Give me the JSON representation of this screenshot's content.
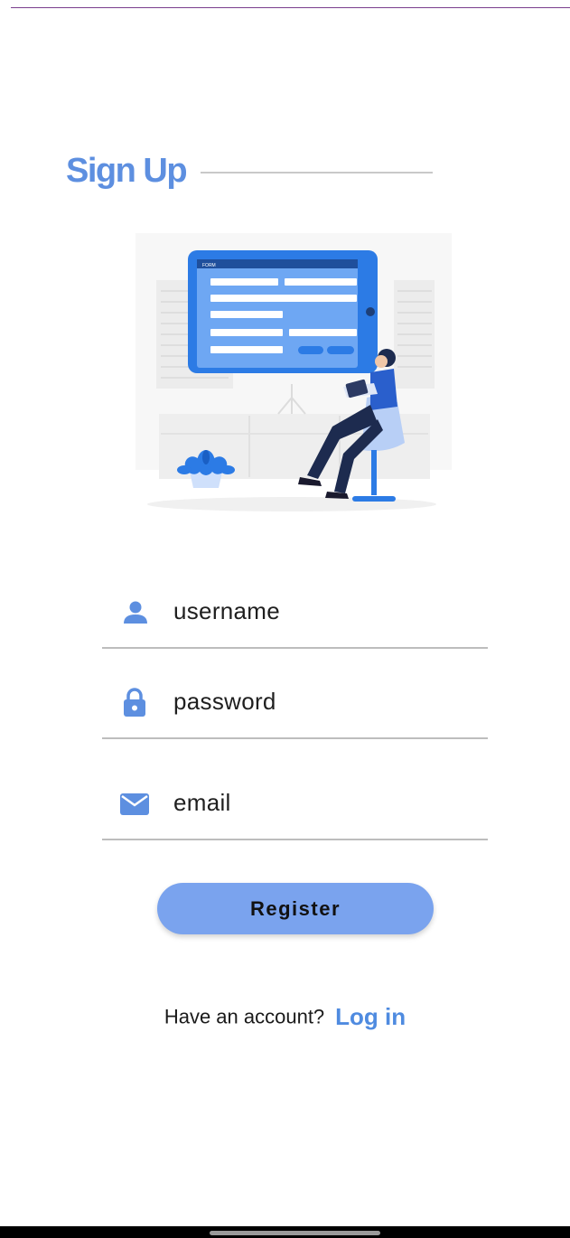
{
  "page": {
    "title": "Sign Up"
  },
  "illustration": {
    "form_header": "FORM"
  },
  "form": {
    "username": {
      "placeholder": "username",
      "icon": "person-icon"
    },
    "password": {
      "placeholder": "password",
      "icon": "lock-icon"
    },
    "email": {
      "placeholder": "email",
      "icon": "mail-icon"
    }
  },
  "register": {
    "label": "Register"
  },
  "login": {
    "prompt": "Have an account?",
    "link": "Log in"
  },
  "colors": {
    "accent": "#5d8fe0",
    "button": "#7aa3ee",
    "link": "#4f8be0"
  }
}
